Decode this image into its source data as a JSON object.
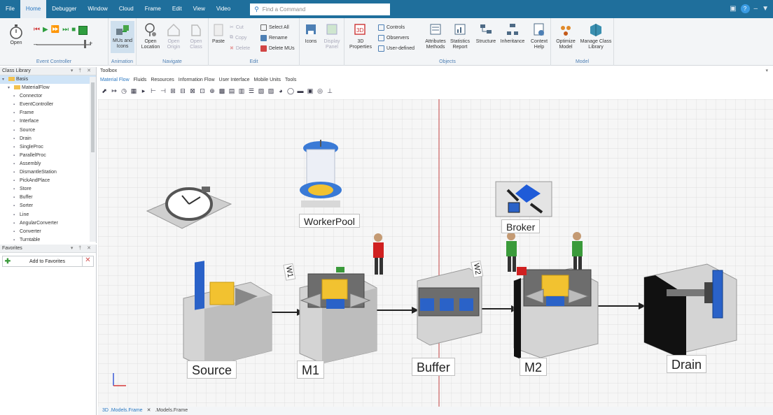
{
  "menubar": {
    "items": [
      "File",
      "Home",
      "Debugger",
      "Window",
      "Cloud",
      "Frame",
      "Edit",
      "View",
      "Video"
    ],
    "active": "Home",
    "command_placeholder": "Find a Command"
  },
  "ribbon": {
    "groups": {
      "event_controller": "Event Controller",
      "animation": "Animation",
      "navigate": "Navigate",
      "edit": "Edit",
      "objects": "Objects",
      "model": "Model"
    },
    "open": "Open",
    "mus_and_icons": "MUs and Icons",
    "open_location": "Open Location",
    "open_origin": "Open Origin",
    "open_class": "Open Class",
    "paste": "Paste",
    "cut": "Cut",
    "copy": "Copy",
    "delete": "Delete",
    "select_all": "Select All",
    "rename": "Rename",
    "delete_mus": "Delete MUs",
    "icons": "Icons",
    "display_panel": "Display Panel",
    "properties_3d": "3D Properties",
    "controls": "Controls",
    "observers": "Observers",
    "user_defined": "User-defined",
    "attributes_methods": "Attributes Methods",
    "statistics_report": "Statistics Report",
    "structure": "Structure",
    "inheritance": "Inheritance",
    "context_help": "Context Help",
    "optimize_model": "Optimize Model",
    "manage_class_library": "Manage Class Library"
  },
  "class_library": {
    "title": "Class Library",
    "items": [
      {
        "label": "Basis",
        "level": 0
      },
      {
        "label": "MaterialFlow",
        "level": 1
      },
      {
        "label": "Connector",
        "level": 2
      },
      {
        "label": "EventController",
        "level": 2
      },
      {
        "label": "Frame",
        "level": 2
      },
      {
        "label": "Interface",
        "level": 2
      },
      {
        "label": "Source",
        "level": 2
      },
      {
        "label": "Drain",
        "level": 2
      },
      {
        "label": "SingleProc",
        "level": 2
      },
      {
        "label": "ParallelProc",
        "level": 2
      },
      {
        "label": "Assembly",
        "level": 2
      },
      {
        "label": "DismantleStation",
        "level": 2
      },
      {
        "label": "PickAndPlace",
        "level": 2
      },
      {
        "label": "Store",
        "level": 2
      },
      {
        "label": "Buffer",
        "level": 2
      },
      {
        "label": "Sorter",
        "level": 2
      },
      {
        "label": "Line",
        "level": 2
      },
      {
        "label": "AngularConverter",
        "level": 2
      },
      {
        "label": "Converter",
        "level": 2
      },
      {
        "label": "Turntable",
        "level": 2
      }
    ]
  },
  "favorites": {
    "title": "Favorites",
    "add_label": "Add to Favorites"
  },
  "toolbox": {
    "title": "Toolbox",
    "tabs": [
      "Material Flow",
      "Fluids",
      "Resources",
      "Information Flow",
      "User Interface",
      "Mobile Units",
      "Tools"
    ],
    "active_tab": "Material Flow"
  },
  "model": {
    "objects": {
      "source": "Source",
      "m1": "M1",
      "buffer": "Buffer",
      "m2": "M2",
      "drain": "Drain",
      "workerpool": "WorkerPool",
      "broker": "Broker"
    },
    "worker_tags": {
      "w1": "W1",
      "w2": "W2"
    }
  },
  "doc_tabs": {
    "active": "3D .Models.Frame",
    "other": ".Models.Frame"
  },
  "colors": {
    "menubar": "#1f6f9c",
    "accent": "#2a78c2",
    "part_yellow": "#f2c230",
    "part_blue": "#2a62c8",
    "worker_green": "#3a9a3a",
    "worker_red": "#d02020"
  }
}
